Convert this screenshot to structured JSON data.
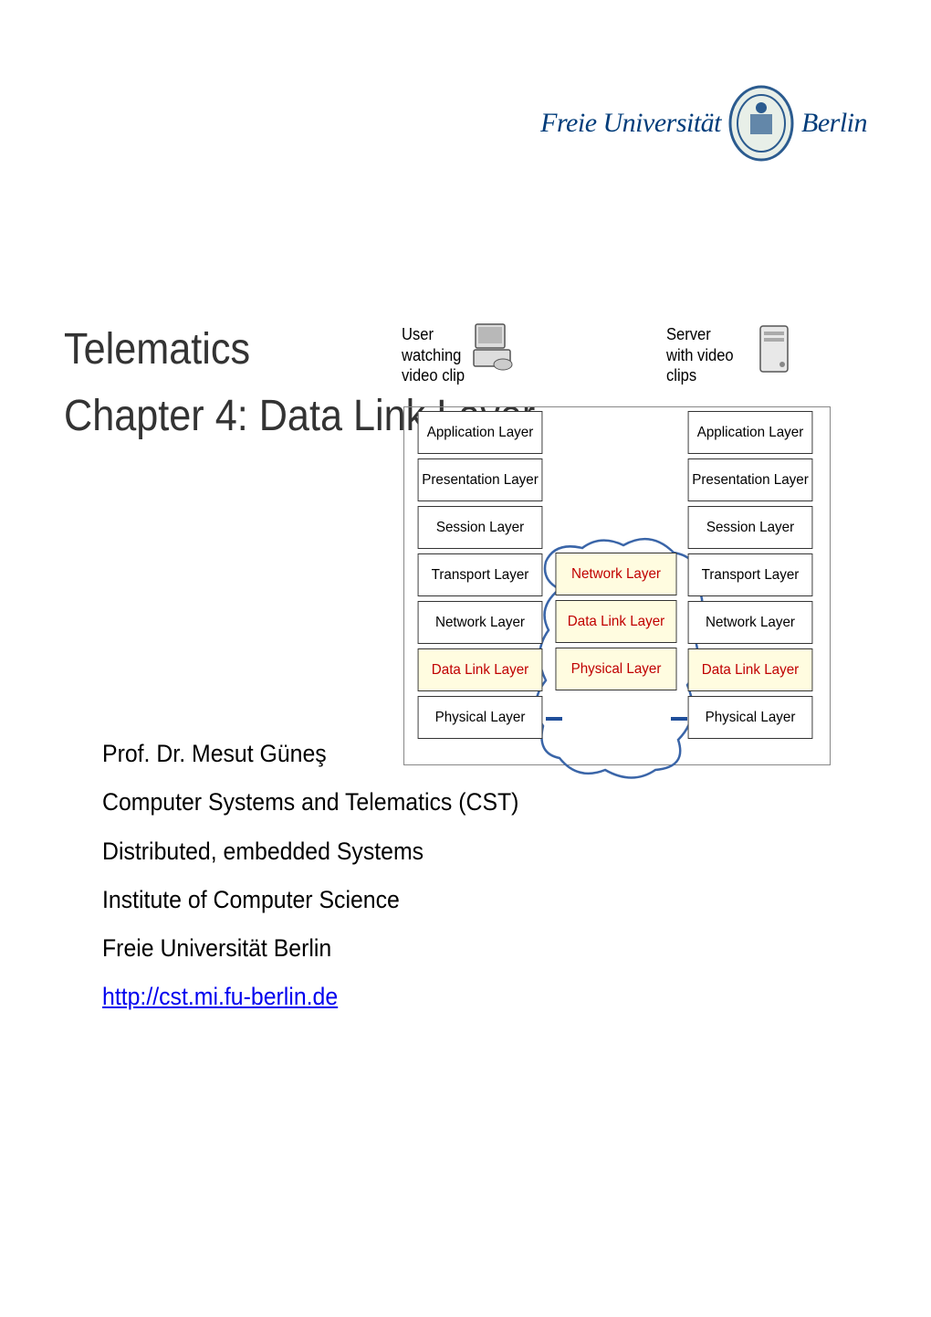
{
  "logo": {
    "text_left": "Freie Universität",
    "text_right": "Berlin"
  },
  "title": {
    "line1": "Telematics",
    "line2": "Chapter 4: Data Link Layer"
  },
  "diagram": {
    "head_left": "User\nwatching\nvideo clip",
    "head_right": "Server\nwith video\nclips",
    "layers_full": [
      "Application Layer",
      "Presentation Layer",
      "Session Layer",
      "Transport Layer",
      "Network Layer",
      "Data Link Layer",
      "Physical Layer"
    ],
    "layers_mid": [
      "Network Layer",
      "Data Link Layer",
      "Physical Layer"
    ],
    "highlight_index_full": 5,
    "highlight_mid": [
      0,
      1,
      2
    ]
  },
  "author": {
    "lines": [
      "Prof. Dr. Mesut Güneş",
      "Computer Systems and Telematics (CST)",
      "Distributed, embedded Systems",
      "Institute of Computer Science",
      "Freie Universität Berlin"
    ],
    "url": "http://cst.mi.fu-berlin.de"
  }
}
